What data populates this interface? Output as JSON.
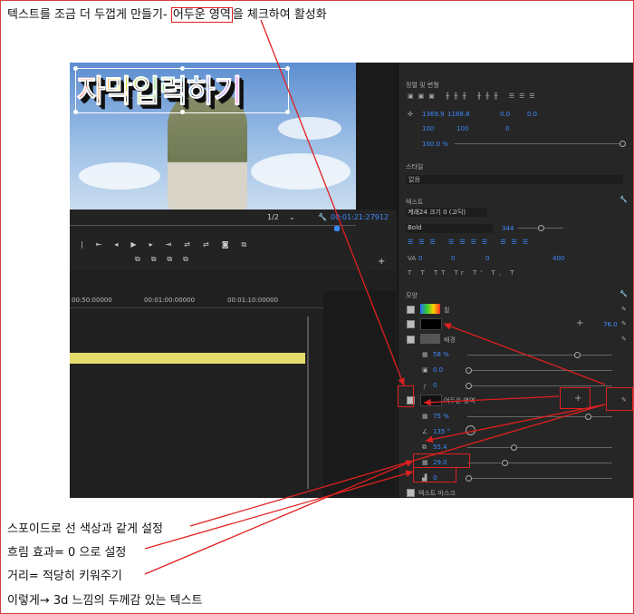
{
  "heading": {
    "before": "텍스트를 조금 더 두껍게 만들기- ",
    "highlight": "어두운 영역",
    "after": "을 체크하여 활성화"
  },
  "video": {
    "subtitle_text": "자막입력하기",
    "zoom": "1/2",
    "timecode": "00:01:21:27912"
  },
  "timeline": {
    "ruler": [
      "00:50:00000",
      "00:01:00:00000",
      "00:01:10:00000"
    ]
  },
  "panel": {
    "align_header": "정렬 및 변형",
    "position": [
      "1369.9",
      "1188.8"
    ],
    "anchor": [
      "0.0",
      "0.0"
    ],
    "scale": "100",
    "scale_pct": "100",
    "rotation": "0",
    "opacity": "100.0 %",
    "style_header": "스타일",
    "style_value": "없음",
    "text_header": "텍스트",
    "font_name": "계래24 크기 0 (고딕)",
    "font_style": "Bold",
    "font_size": "344",
    "tracking_values": [
      "0",
      "0",
      "0",
      "400"
    ],
    "appearance_header": "모양",
    "fill_label": "칠",
    "stroke_value": "76.0",
    "background_label": "배경",
    "bg_opacity": "58 %",
    "bg_size": "0.0",
    "bg_corner": "0",
    "shadow_label": "어두운 영역",
    "shadow_opacity": "75 %",
    "shadow_angle": "135 °",
    "shadow_distance": "55.4",
    "shadow_size": "29.0",
    "shadow_blur": "0",
    "mask_label": "텍스트 마스크"
  },
  "notes": [
    "스포이드로 선 색상과 같게 설정",
    "흐림 효과= 0 으로 설정",
    "거리= 적당히 키워주기",
    "이렇게→  3d 느낌의 두께감 있는 텍스트"
  ],
  "colors": {
    "annotation_red": "#e02020",
    "value_blue": "#3d8bff",
    "clip_yellow": "#e6dc6b"
  }
}
